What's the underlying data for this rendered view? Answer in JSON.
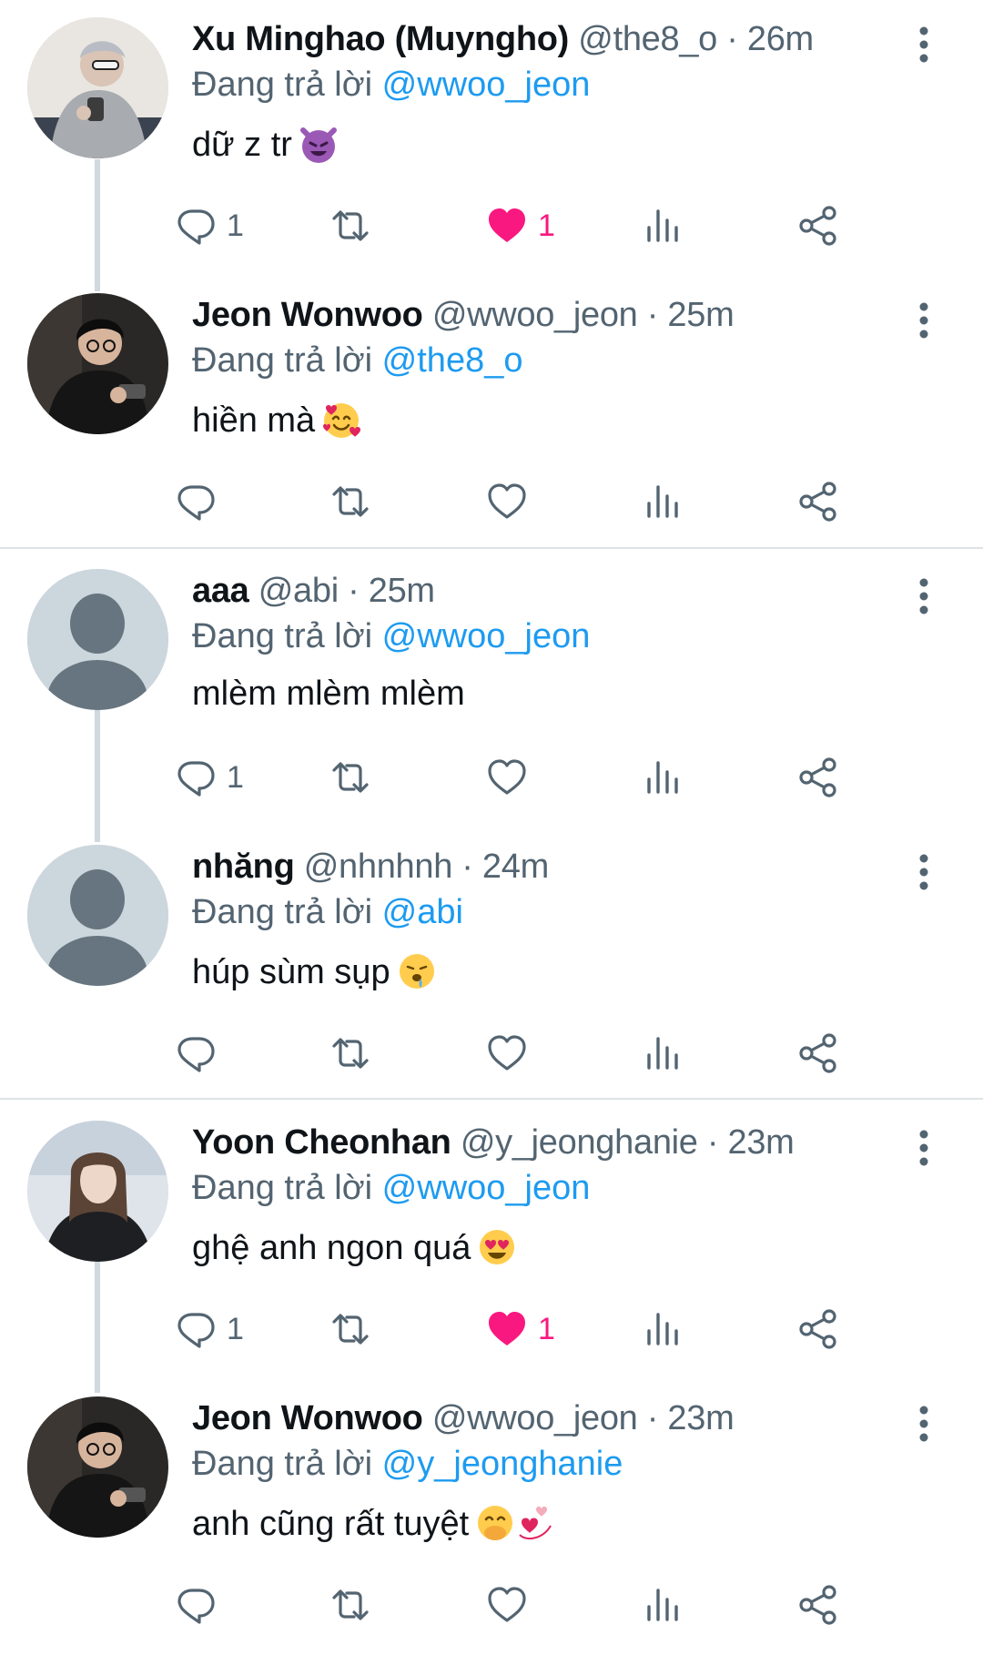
{
  "colors": {
    "link": "#1d9bf0",
    "secondary": "#536471",
    "like": "#f91880",
    "line": "#cfd9de"
  },
  "tweets": [
    {
      "name": "Xu Minghao (Muyngho)",
      "handle": "@the8_o",
      "dot": "·",
      "time": "26m",
      "reply_prefix": "Đang trả lời",
      "reply_to": "@wwoo_jeon",
      "text": "dữ z tr",
      "emoji": "smiling-devil-emoji",
      "avatar": "photo-gray-hoodie",
      "replies": "1",
      "likes": "1",
      "liked": true
    },
    {
      "name": "Jeon Wonwoo",
      "handle": "@wwoo_jeon",
      "dot": "·",
      "time": "25m",
      "reply_prefix": "Đang trả lời",
      "reply_to": "@the8_o",
      "text": "hiền mà",
      "emoji": "smiling-face-with-hearts-emoji",
      "avatar": "photo-dark-phone",
      "replies": "",
      "likes": "",
      "liked": false
    },
    {
      "name": "aaa",
      "handle": "@abi",
      "dot": "·",
      "time": "25m",
      "reply_prefix": "Đang trả lời",
      "reply_to": "@wwoo_jeon",
      "text": "mlèm mlèm mlèm",
      "emoji": "",
      "avatar": "default",
      "replies": "1",
      "likes": "",
      "liked": false
    },
    {
      "name": "nhăng",
      "handle": "@nhnhnh",
      "dot": "·",
      "time": "24m",
      "reply_prefix": "Đang trả lời",
      "reply_to": "@abi",
      "text": "húp sùm sụp",
      "emoji": "drooling-face-emoji",
      "avatar": "default",
      "replies": "",
      "likes": "",
      "liked": false
    },
    {
      "name": "Yoon Cheonhan",
      "handle": "@y_jeonghanie",
      "dot": "·",
      "time": "23m",
      "reply_prefix": "Đang trả lời",
      "reply_to": "@wwoo_jeon",
      "text": "ghệ anh ngon quá",
      "emoji": "heart-eyes-emoji",
      "avatar": "photo-long-hair",
      "replies": "1",
      "likes": "1",
      "liked": true
    },
    {
      "name": "Jeon Wonwoo",
      "handle": "@wwoo_jeon",
      "dot": "·",
      "time": "23m",
      "reply_prefix": "Đang trả lời",
      "reply_to": "@y_jeonghanie",
      "text": "anh cũng rất tuyệt",
      "emoji": "hand-over-mouth-and-revolving-hearts-emoji",
      "avatar": "photo-dark-phone",
      "replies": "",
      "likes": "",
      "liked": false
    }
  ]
}
